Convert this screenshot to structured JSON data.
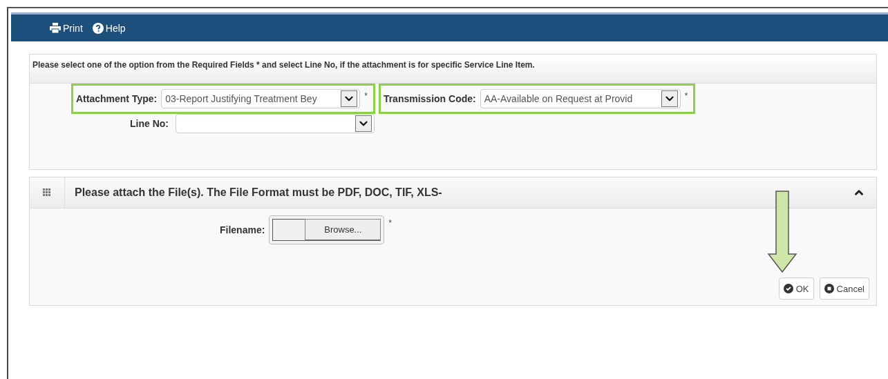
{
  "toolbar": {
    "items": [
      {
        "kind": "print",
        "label": "Print"
      },
      {
        "kind": "help",
        "label": "Help"
      }
    ]
  },
  "required_panel": {
    "instruction": "Please select one of the option from the Required Fields * and select Line No, if the attachment is for specific Service Line Item.",
    "attachment_type": {
      "label": "Attachment Type:",
      "value": "03-Report Justifying Treatment Bey",
      "required_mark": "*",
      "highlighted": true
    },
    "transmission_code": {
      "label": "Transmission Code:",
      "value": "AA-Available on Request at Provid",
      "required_mark": "*",
      "highlighted": true
    },
    "line_no": {
      "label": "Line No:"
    }
  },
  "file_panel": {
    "title": "Please attach the File(s). The File Format must be PDF, DOC, TIF, XLS-",
    "expanded": true,
    "filename": {
      "label": "Filename:",
      "button": "Browse...",
      "required_mark": "*"
    },
    "buttons": [
      {
        "kind": "ok",
        "label": "OK"
      },
      {
        "kind": "cancel",
        "label": "Cancel"
      }
    ]
  },
  "annotation": {
    "kind": "down-arrow"
  }
}
